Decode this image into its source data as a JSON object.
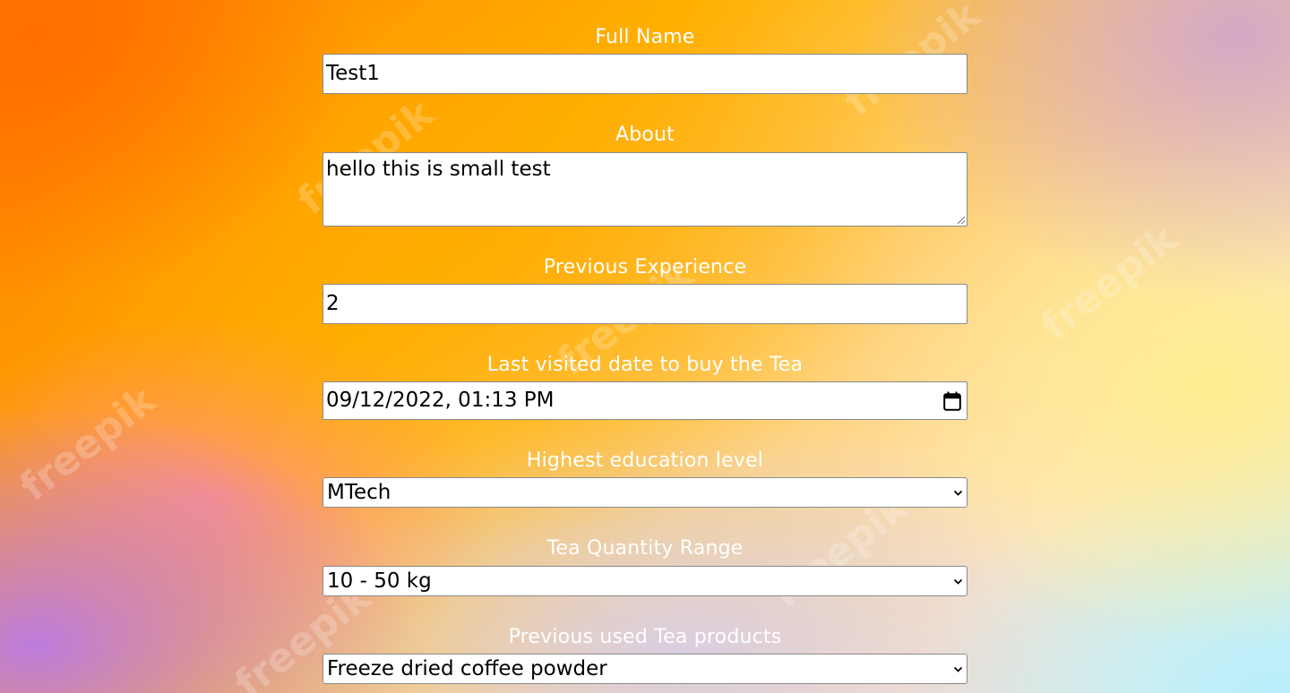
{
  "watermark_text": "freepik",
  "fields": {
    "full_name": {
      "label": "Full Name",
      "value": "Test1"
    },
    "about": {
      "label": "About",
      "value": "hello this is small test"
    },
    "experience": {
      "label": "Previous Experience",
      "value": "2"
    },
    "last_visit": {
      "label": "Last visited date to buy the Tea",
      "value": "09/12/2022, 01:13 PM"
    },
    "education": {
      "label": "Highest education level",
      "value": "MTech"
    },
    "quantity": {
      "label": "Tea Quantity Range",
      "value": "10 - 50 kg"
    },
    "products": {
      "label": "Previous used Tea products",
      "value": "Freeze dried coffee powder"
    }
  },
  "icons": {
    "calendar": "calendar-icon",
    "dropdown": "chevron-down-icon"
  },
  "colors": {
    "label_text": "#ffffff",
    "control_background": "#ffffff",
    "control_border": "#8a8a8a"
  }
}
